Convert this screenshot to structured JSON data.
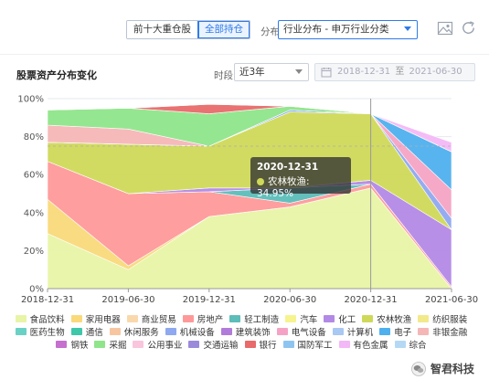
{
  "toolbar": {
    "tabs": [
      {
        "label": "前十大重仓股",
        "active": false
      },
      {
        "label": "全部持仓",
        "active": true
      }
    ],
    "dist_label": "分布",
    "dist_value": "行业分布 - 申万行业分类",
    "icons": [
      "image-icon",
      "refresh-icon"
    ]
  },
  "panel": {
    "title": "股票资产分布变化",
    "period_label": "时段",
    "period_value": "近3年",
    "date_start": "2018-12-31",
    "date_sep": "至",
    "date_end": "2021-06-30"
  },
  "tooltip": {
    "date": "2020-12-31",
    "text": "农林牧渔: 34.95%",
    "color": "#cfd959"
  },
  "watermark": "智君科技",
  "chart_data": {
    "type": "area",
    "stacked": true,
    "x": [
      "2018-12-31",
      "2019-06-30",
      "2019-12-31",
      "2020-06-30",
      "2020-12-31",
      "2021-06-30"
    ],
    "ylim": [
      0,
      100
    ],
    "yticks": [
      "0%",
      "20%",
      "40%",
      "60%",
      "80%",
      "100%"
    ],
    "grid": true,
    "legend_position": "bottom",
    "series": [
      {
        "name": "食品饮料",
        "color": "#e8f4a6",
        "values": [
          29,
          10,
          38,
          43,
          53,
          0
        ]
      },
      {
        "name": "家用电器",
        "color": "#f9d97a",
        "values": [
          18,
          2,
          0,
          0,
          0,
          0
        ]
      },
      {
        "name": "商业贸易",
        "color": "#f9d9ab",
        "values": [
          0,
          0,
          0,
          0,
          0,
          0
        ]
      },
      {
        "name": "房地产",
        "color": "#ff9999",
        "values": [
          20,
          38,
          13,
          2,
          2,
          1
        ]
      },
      {
        "name": "轻工制造",
        "color": "#5cbdb9",
        "values": [
          0,
          0,
          0,
          8,
          0,
          0
        ]
      },
      {
        "name": "汽车",
        "color": "#f7f38e",
        "values": [
          0,
          0,
          0,
          0,
          0,
          0
        ]
      },
      {
        "name": "化工",
        "color": "#b389e6",
        "values": [
          0,
          0,
          2,
          0,
          2,
          30
        ]
      },
      {
        "name": "农林牧渔",
        "color": "#cfd959",
        "values": [
          10,
          26,
          22,
          40,
          35,
          0
        ]
      },
      {
        "name": "纺织服装",
        "color": "#f2e98a",
        "values": [
          0,
          0,
          0,
          0,
          0,
          0
        ]
      },
      {
        "name": "医药生物",
        "color": "#6ad1c4",
        "values": [
          0,
          0,
          0,
          0,
          0,
          0
        ]
      },
      {
        "name": "通信",
        "color": "#3ec7a8",
        "values": [
          0,
          0,
          0,
          0,
          0,
          0
        ]
      },
      {
        "name": "休闲服务",
        "color": "#f7c6a0",
        "values": [
          0,
          0,
          0,
          0,
          0,
          0
        ]
      },
      {
        "name": "机械设备",
        "color": "#8fa8f0",
        "values": [
          0,
          0,
          0,
          1,
          0,
          6
        ]
      },
      {
        "name": "建筑装饰",
        "color": "#b07cd9",
        "values": [
          0,
          0,
          0,
          0,
          0,
          0
        ]
      },
      {
        "name": "电气设备",
        "color": "#f5a3c4",
        "values": [
          0,
          0,
          0,
          0,
          0,
          15
        ]
      },
      {
        "name": "计算机",
        "color": "#a9c8f2",
        "values": [
          0,
          0,
          0,
          0,
          0,
          0
        ]
      },
      {
        "name": "电子",
        "color": "#4fb0ee",
        "values": [
          0,
          0,
          0,
          0,
          0,
          20
        ]
      },
      {
        "name": "非银金融",
        "color": "#f5b6b6",
        "values": [
          9,
          8,
          0,
          0,
          0,
          0
        ]
      },
      {
        "name": "钢铁",
        "color": "#c56fcf",
        "values": [
          0,
          0,
          0,
          0,
          0,
          0
        ]
      },
      {
        "name": "采掘",
        "color": "#8fe58a",
        "values": [
          8,
          11,
          17,
          2,
          0,
          0
        ]
      },
      {
        "name": "公用事业",
        "color": "#f9c6dc",
        "values": [
          0,
          0,
          0,
          0,
          0,
          0
        ]
      },
      {
        "name": "交通运输",
        "color": "#9b8ad9",
        "values": [
          0,
          0,
          0,
          0,
          0,
          0
        ]
      },
      {
        "name": "银行",
        "color": "#e86a6a",
        "values": [
          0,
          0,
          5,
          0,
          0,
          0
        ]
      },
      {
        "name": "国防军工",
        "color": "#8ec5f0",
        "values": [
          0,
          0,
          0,
          0,
          0,
          0
        ]
      },
      {
        "name": "有色金属",
        "color": "#f3b8f7",
        "values": [
          0,
          0,
          0,
          0,
          0,
          5
        ]
      },
      {
        "name": "综合",
        "color": "#b5d9f5",
        "values": [
          0,
          0,
          0,
          0,
          0,
          0
        ]
      }
    ]
  }
}
